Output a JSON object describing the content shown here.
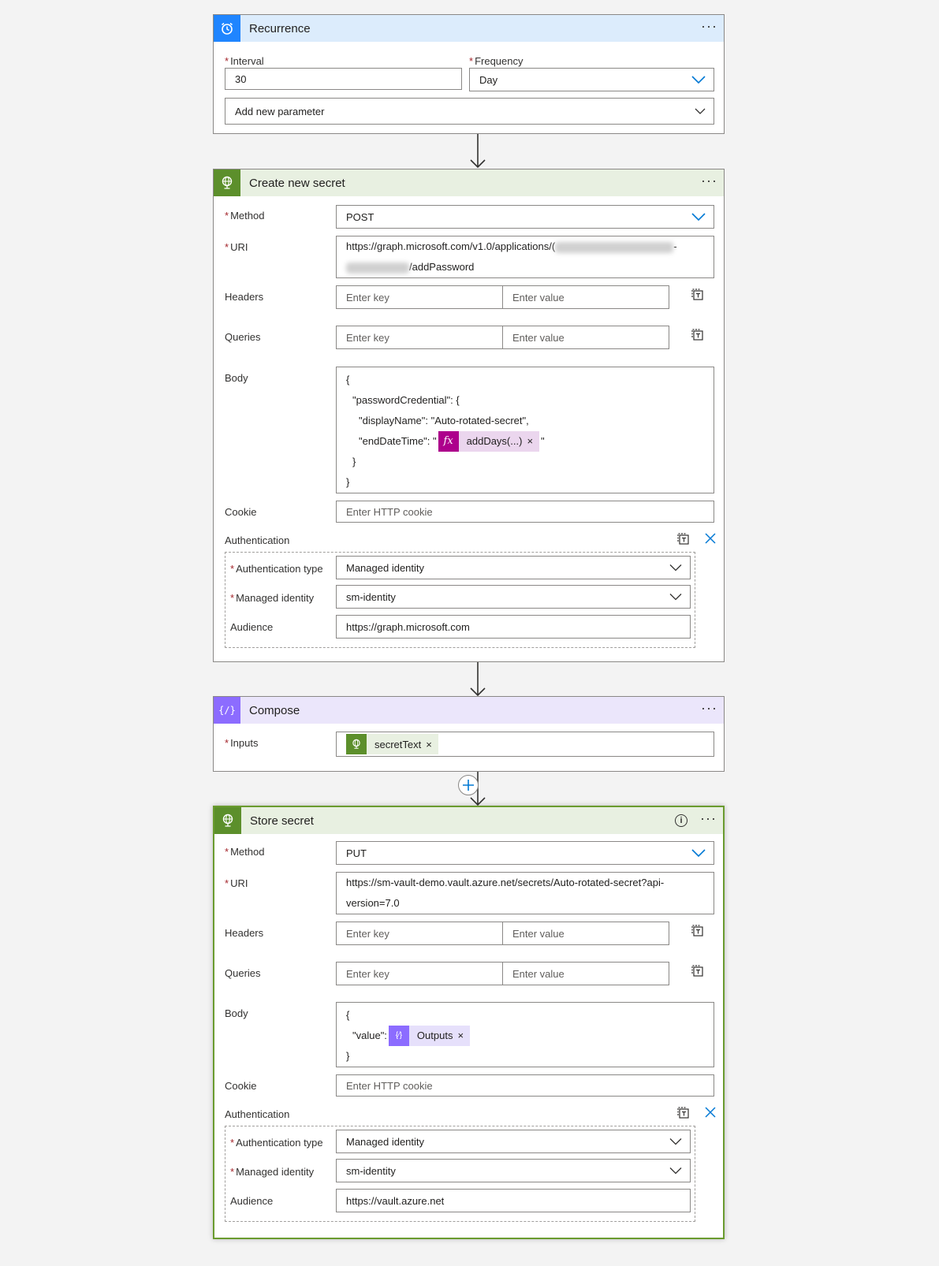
{
  "recurrence": {
    "title": "Recurrence",
    "interval_label": "Interval",
    "interval_value": "30",
    "frequency_label": "Frequency",
    "frequency_value": "Day",
    "add_param_label": "Add new parameter",
    "more": "···"
  },
  "create_secret": {
    "title": "Create new secret",
    "method_label": "Method",
    "method_value": "POST",
    "uri_label": "URI",
    "uri_line1_prefix": "https://graph.microsoft.com/v1.0/applications/(",
    "uri_line1_suffix": "-",
    "uri_line2_suffix": "/addPassword",
    "headers_label": "Headers",
    "queries_label": "Queries",
    "key_placeholder": "Enter key",
    "value_placeholder": "Enter value",
    "body_label": "Body",
    "body_lines": [
      "{",
      "\"passwordCredential\": {",
      "\"displayName\": \"Auto-rotated-secret\",",
      "\"endDateTime\": \"",
      "}",
      "}"
    ],
    "body_token": "addDays(...)",
    "body_token_end": "\"",
    "cookie_label": "Cookie",
    "cookie_placeholder": "Enter HTTP cookie",
    "auth_label": "Authentication",
    "auth_type_label": "Authentication type",
    "auth_type_value": "Managed identity",
    "managed_identity_label": "Managed identity",
    "managed_identity_value": "sm-identity",
    "audience_label": "Audience",
    "audience_value": "https://graph.microsoft.com",
    "more": "···"
  },
  "compose": {
    "title": "Compose",
    "inputs_label": "Inputs",
    "token": "secretText",
    "more": "···"
  },
  "store_secret": {
    "title": "Store secret",
    "method_label": "Method",
    "method_value": "PUT",
    "uri_label": "URI",
    "uri_line1": "https://sm-vault-demo.vault.azure.net/secrets/Auto-rotated-secret?api-",
    "uri_line2": "version=7.0",
    "headers_label": "Headers",
    "queries_label": "Queries",
    "key_placeholder": "Enter key",
    "value_placeholder": "Enter value",
    "body_label": "Body",
    "body_line1": "{",
    "body_line2_prefix": "\"value\":",
    "body_token": "Outputs",
    "body_line3": "}",
    "cookie_label": "Cookie",
    "cookie_placeholder": "Enter HTTP cookie",
    "auth_label": "Authentication",
    "auth_type_label": "Authentication type",
    "auth_type_value": "Managed identity",
    "managed_identity_label": "Managed identity",
    "managed_identity_value": "sm-identity",
    "audience_label": "Audience",
    "audience_value": "https://vault.azure.net",
    "more": "···"
  },
  "common": {
    "required_mark": "*",
    "token_remove": "×"
  },
  "colors": {
    "recurrence": "#1f85ff",
    "http": "#5c8f2b",
    "compose": "#8c6cff",
    "expression": "#ad008c",
    "link_blue": "#0078d4"
  }
}
